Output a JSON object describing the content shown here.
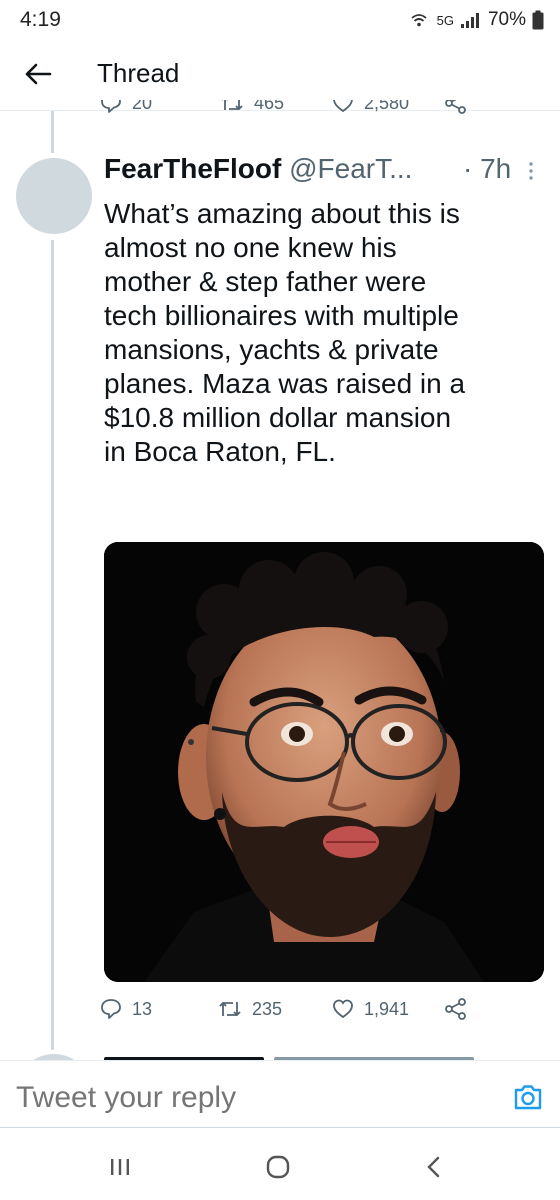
{
  "status_bar": {
    "time": "4:19",
    "network": "5G",
    "battery": "70%"
  },
  "header": {
    "title": "Thread",
    "back_icon": "arrow-left-icon"
  },
  "previous_tweet_actions": {
    "replies": "20",
    "retweets": "465",
    "likes": "2,580"
  },
  "tweet": {
    "display_name": "FearTheFloof",
    "handle": "@FearT...",
    "time": "· 7h",
    "text_lines": [
      "What’s amazing about this is",
      "almost no one knew his",
      "mother & step father were",
      "tech billionaires with multiple",
      "mansions, yachts & private",
      "planes. Maza was raised in a",
      "$10.8 million dollar mansion",
      "in Boca Raton, FL."
    ],
    "replies": "13",
    "retweets": "235",
    "likes": "1,941"
  },
  "reply_bar": {
    "placeholder": "Tweet your reply"
  },
  "colors": {
    "text": "#0f1419",
    "secondary": "#536471",
    "accent": "#1d9bf0",
    "line": "#cfd9de"
  }
}
